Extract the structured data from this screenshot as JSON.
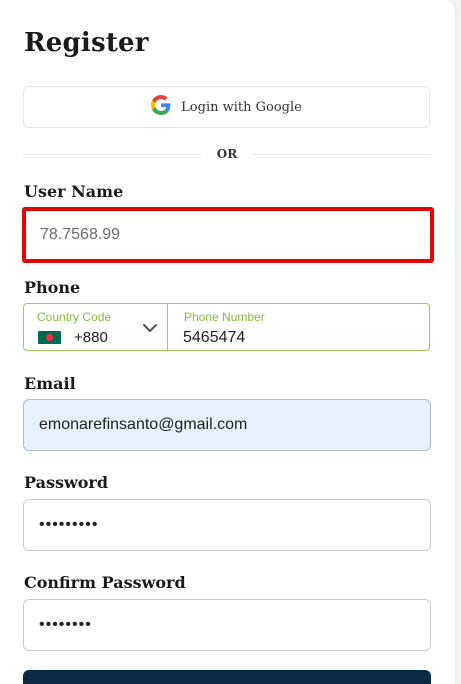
{
  "form": {
    "title": "Register",
    "google_button_label": "Login with Google",
    "divider_text": "OR",
    "username": {
      "label": "User Name",
      "value": "78.7568.99"
    },
    "phone": {
      "label": "Phone",
      "country_code_label": "Country Code",
      "country_code_value": "+880",
      "country_flag": "bangladesh-flag",
      "number_label": "Phone Number",
      "number_value": "5465474"
    },
    "email": {
      "label": "Email",
      "value": "emonarefinsanto@gmail.com"
    },
    "password": {
      "label": "Password",
      "value": "•••••••••"
    },
    "confirm_password": {
      "label": "Confirm Password",
      "value": "••••••••"
    }
  },
  "colors": {
    "highlight_border": "#e10600",
    "phone_border": "#a3c95b",
    "email_autofill_bg": "#e8f0fe",
    "submit_bg": "#0b2a45"
  }
}
